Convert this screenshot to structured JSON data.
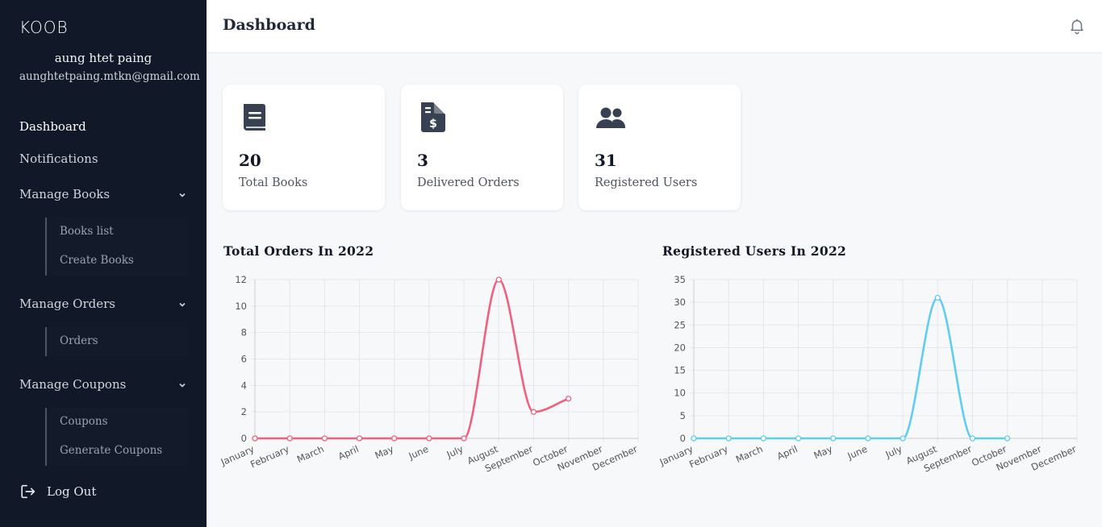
{
  "sidebar": {
    "logo": "KOOB",
    "user_name": "aung htet paing",
    "user_email": "aunghtetpaing.mtkn@gmail.com",
    "nav": {
      "dashboard": "Dashboard",
      "notifications": "Notifications",
      "manage_books": "Manage Books",
      "books_list": "Books list",
      "create_books": "Create Books",
      "manage_orders": "Manage Orders",
      "orders": "Orders",
      "manage_coupons": "Manage Coupons",
      "coupons": "Coupons",
      "generate_coupons": "Generate Coupons",
      "logout": "Log Out"
    }
  },
  "header": {
    "title": "Dashboard"
  },
  "cards": [
    {
      "value": "20",
      "label": "Total Books",
      "icon": "book-icon"
    },
    {
      "value": "3",
      "label": "Delivered Orders",
      "icon": "invoice-dollar-icon"
    },
    {
      "value": "31",
      "label": "Registered Users",
      "icon": "users-icon"
    }
  ],
  "colors": {
    "orders_line": "#f0607f",
    "users_line": "#5ecdf0",
    "sidebar_bg": "#111827"
  },
  "chart_data": [
    {
      "type": "line",
      "title": "Total Orders In 2022",
      "categories": [
        "January",
        "February",
        "March",
        "April",
        "May",
        "June",
        "July",
        "August",
        "September",
        "October",
        "November",
        "December"
      ],
      "series": [
        {
          "values": [
            0,
            0,
            0,
            0,
            0,
            0,
            0,
            12,
            2,
            3
          ]
        }
      ],
      "ylim": [
        0,
        12
      ],
      "yticks": [
        0,
        2,
        4,
        6,
        8,
        10,
        12
      ],
      "grid": true,
      "color": "#f0607f"
    },
    {
      "type": "line",
      "title": "Registered Users In 2022",
      "categories": [
        "January",
        "February",
        "March",
        "April",
        "May",
        "June",
        "July",
        "August",
        "September",
        "October",
        "November",
        "December"
      ],
      "series": [
        {
          "values": [
            0,
            0,
            0,
            0,
            0,
            0,
            0,
            31,
            0,
            0
          ]
        }
      ],
      "ylim": [
        0,
        35
      ],
      "yticks": [
        0,
        5,
        10,
        15,
        20,
        25,
        30,
        35
      ],
      "grid": true,
      "color": "#5ecdf0"
    }
  ]
}
